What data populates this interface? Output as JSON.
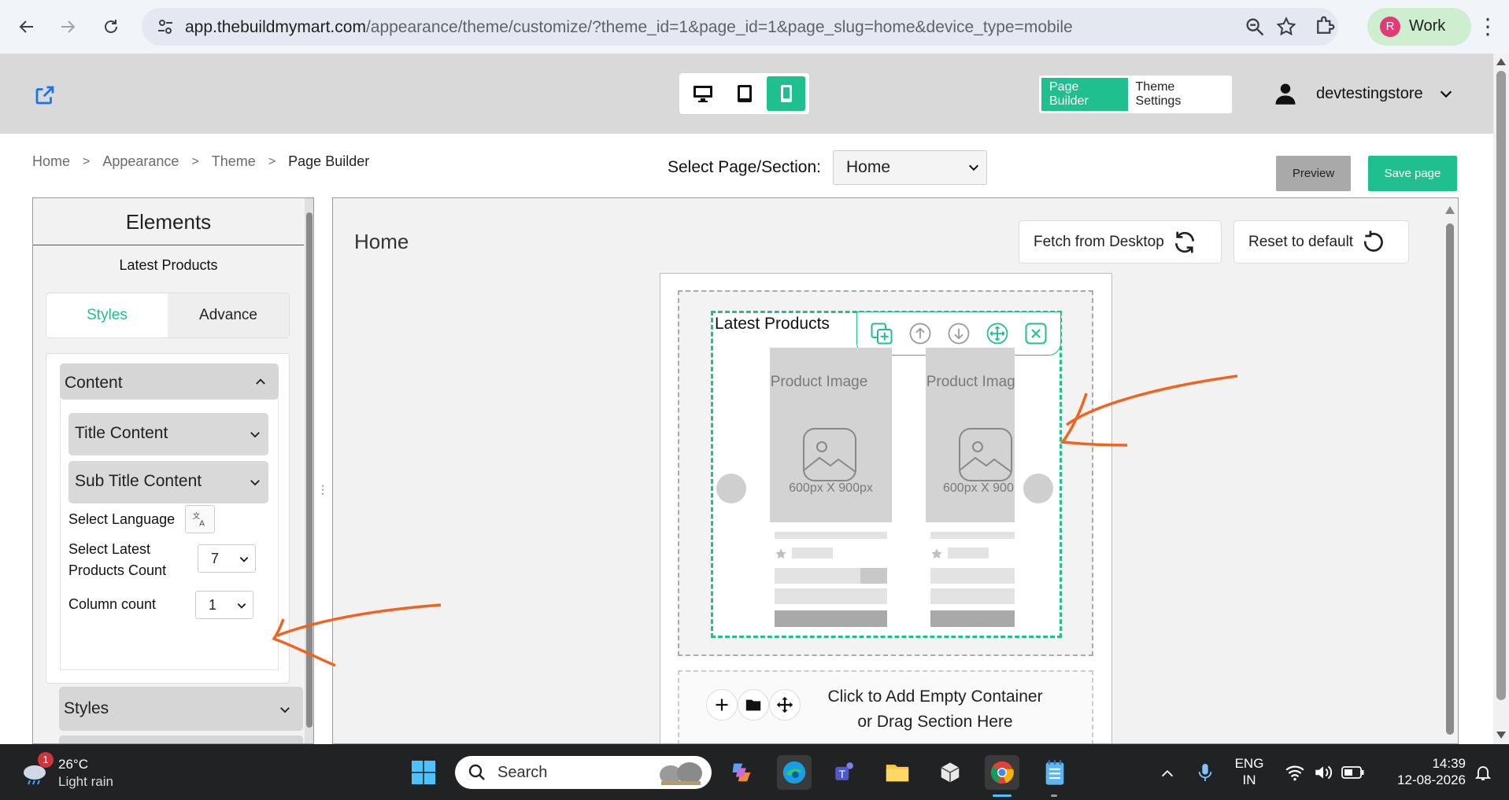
{
  "browser": {
    "url_host": "app.thebuildmymart.com",
    "url_path": "/appearance/theme/customize/?theme_id=1&page_id=1&page_slug=home&device_type=mobile",
    "profile_initial": "R",
    "profile_label": "Work"
  },
  "header": {
    "mode_tabs": [
      "Page Builder",
      "Theme Settings"
    ],
    "active_mode": "Page Builder",
    "username": "devtestingstore",
    "active_device": "mobile"
  },
  "breadcrumb": [
    "Home",
    "Appearance",
    "Theme",
    "Page Builder"
  ],
  "page_select": {
    "label": "Select Page/Section:",
    "value": "Home"
  },
  "actions": {
    "preview": "Preview",
    "save": "Save page"
  },
  "left_panel": {
    "title": "Elements",
    "subtitle": "Latest Products",
    "tabs": [
      "Styles",
      "Advance"
    ],
    "active_tab": "Styles",
    "content_section": "Content",
    "sub_sections": [
      "Title Content",
      "Sub Title Content"
    ],
    "select_language_label": "Select Language",
    "latest_count_label": "Select Latest Products Count",
    "latest_count_value": "7",
    "column_count_label": "Column count",
    "column_count_value": "1",
    "styles_section": "Styles"
  },
  "canvas": {
    "page_title": "Home",
    "fetch_button": "Fetch from Desktop",
    "reset_button": "Reset to default",
    "block_title": "Latest Products",
    "product_placeholder_text": "Product Image",
    "product_size_text_1": "600px X 900px",
    "product_size_text_2": "600px X 900",
    "empty_container_text_1": "Click to Add Empty Container",
    "empty_container_text_2": "or Drag Section Here"
  },
  "taskbar": {
    "temperature": "26°C",
    "weather": "Light rain",
    "weather_badge": "1",
    "search_placeholder": "Search",
    "lang_1": "ENG",
    "lang_2": "IN",
    "time": "14:39",
    "date": "12-08-2026"
  },
  "colors": {
    "accent": "#1fbf8f",
    "annotation": "#f06422"
  }
}
